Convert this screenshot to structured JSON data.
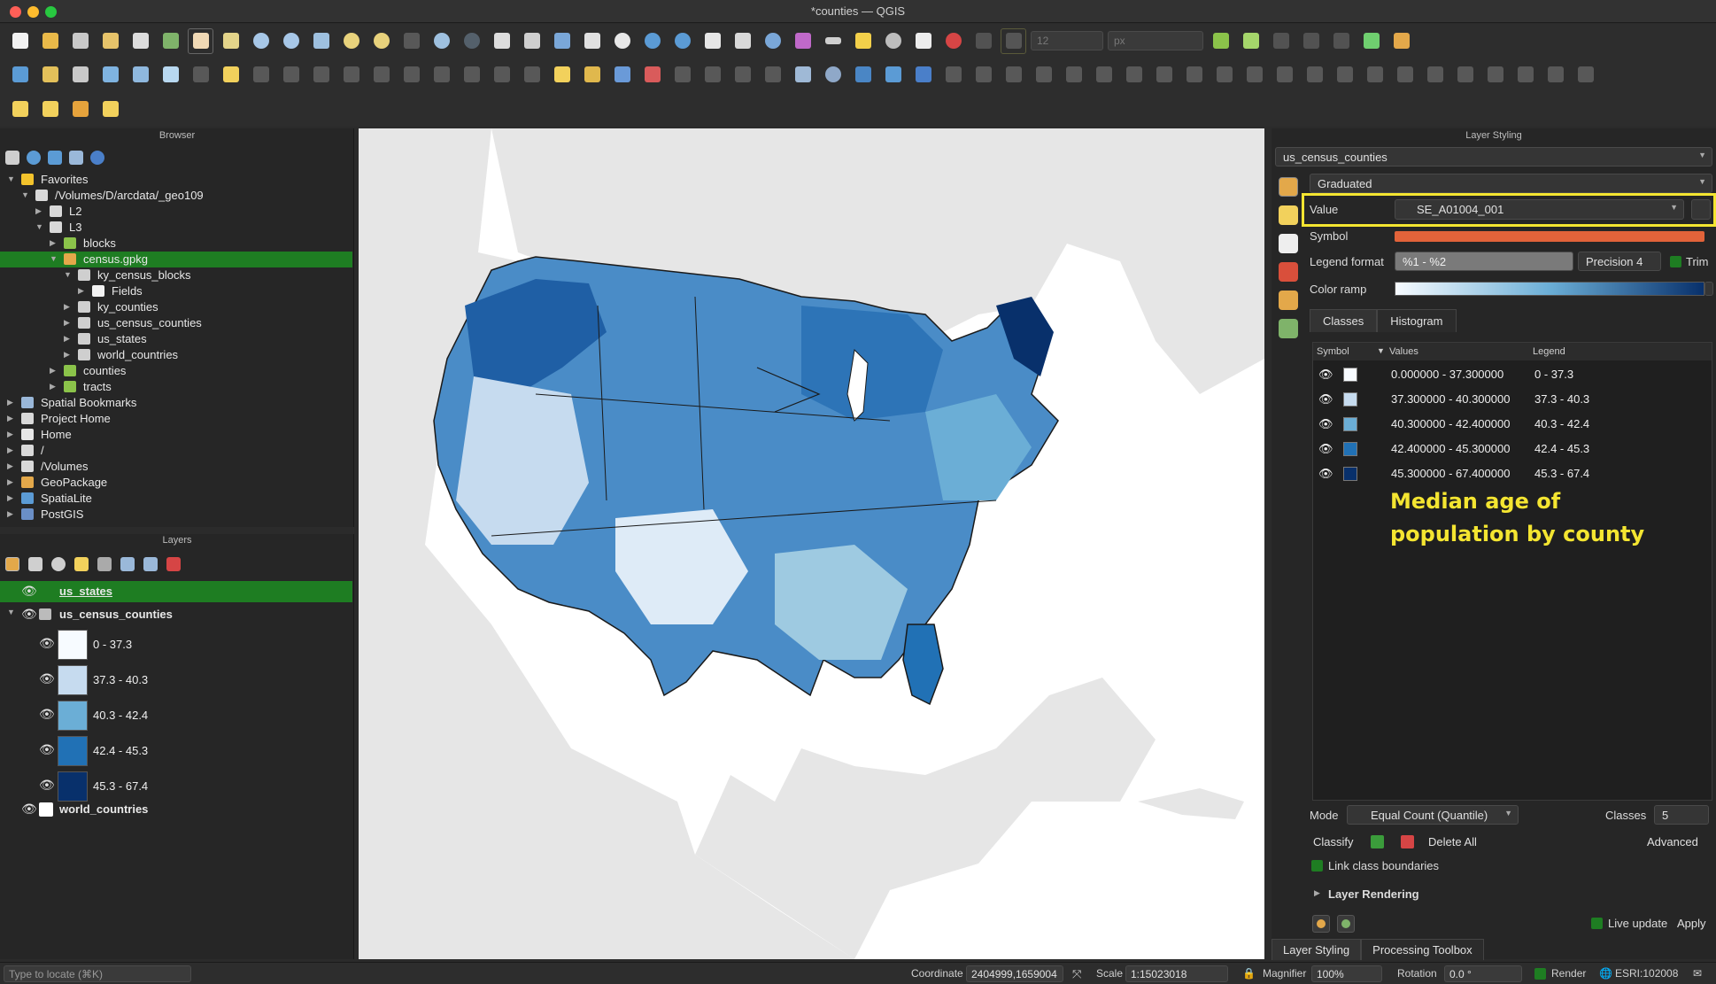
{
  "window": {
    "title": "*counties — QGIS"
  },
  "toolbar": {
    "font_size_value": "12",
    "font_unit_value": "px"
  },
  "browser": {
    "title": "Browser",
    "items": [
      {
        "label": "Favorites",
        "icon": "star-icon"
      },
      {
        "label": "/Volumes/D/arcdata/_geo109",
        "icon": "folder-icon"
      },
      {
        "label": "L2",
        "icon": "folder-icon"
      },
      {
        "label": "L3",
        "icon": "folder-icon"
      },
      {
        "label": "blocks",
        "icon": "query-icon"
      },
      {
        "label": "census.gpkg",
        "icon": "geopackage-icon"
      },
      {
        "label": "ky_census_blocks",
        "icon": "polygon-layer-icon"
      },
      {
        "label": "Fields",
        "icon": "fields-icon"
      },
      {
        "label": "ky_counties",
        "icon": "polygon-layer-icon"
      },
      {
        "label": "us_census_counties",
        "icon": "polygon-layer-icon"
      },
      {
        "label": "us_states",
        "icon": "polygon-layer-icon"
      },
      {
        "label": "world_countries",
        "icon": "polygon-layer-icon"
      },
      {
        "label": "counties",
        "icon": "query-icon"
      },
      {
        "label": "tracts",
        "icon": "query-icon"
      },
      {
        "label": "Spatial Bookmarks",
        "icon": "bookmark-icon"
      },
      {
        "label": "Project Home",
        "icon": "folder-icon"
      },
      {
        "label": "Home",
        "icon": "home-icon"
      },
      {
        "label": "/",
        "icon": "folder-icon"
      },
      {
        "label": "/Volumes",
        "icon": "folder-icon"
      },
      {
        "label": "GeoPackage",
        "icon": "geopackage-icon"
      },
      {
        "label": "SpatiaLite",
        "icon": "spatialite-icon"
      },
      {
        "label": "PostGIS",
        "icon": "postgis-icon"
      }
    ]
  },
  "layers": {
    "title": "Layers",
    "items": [
      {
        "label": "us_states"
      },
      {
        "label": "us_census_counties"
      },
      {
        "label": "world_countries"
      }
    ],
    "legend": [
      {
        "label": "0 - 37.3",
        "color": "#f7fbff"
      },
      {
        "label": "37.3 - 40.3",
        "color": "#c6dbef"
      },
      {
        "label": "40.3 - 42.4",
        "color": "#6baed6"
      },
      {
        "label": "42.4 - 45.3",
        "color": "#2171b5"
      },
      {
        "label": "45.3 - 67.4",
        "color": "#08306b"
      }
    ]
  },
  "styling": {
    "title": "Layer Styling",
    "layer": "us_census_counties",
    "renderer": "Graduated",
    "value_label": "Value",
    "value": "SE_A01004_001",
    "symbol_label": "Symbol",
    "legend_format_label": "Legend format",
    "legend_format": "%1 - %2",
    "precision": "Precision 4",
    "trim": "Trim",
    "color_ramp_label": "Color ramp",
    "tabs": [
      "Classes",
      "Histogram"
    ],
    "columns": [
      "Symbol",
      "Values",
      "Legend"
    ],
    "classes": [
      {
        "values": "0.000000 - 37.300000",
        "legend": "0 - 37.3",
        "color": "#f7fbff"
      },
      {
        "values": "37.300000 - 40.300000",
        "legend": "37.3 - 40.3",
        "color": "#c6dbef"
      },
      {
        "values": "40.300000 - 42.400000",
        "legend": "40.3 - 42.4",
        "color": "#6baed6"
      },
      {
        "values": "42.400000 - 45.300000",
        "legend": "42.4 - 45.3",
        "color": "#2171b5"
      },
      {
        "values": "45.300000 - 67.400000",
        "legend": "45.3 - 67.4",
        "color": "#08306b"
      }
    ],
    "annotation": "Median age of population by county",
    "mode_label": "Mode",
    "mode": "Equal Count (Quantile)",
    "classes_label": "Classes",
    "classes_count": "5",
    "classify": "Classify",
    "delete_all": "Delete All",
    "advanced": "Advanced",
    "link_boundaries": "Link class boundaries",
    "layer_rendering": "Layer Rendering",
    "live_update": "Live update",
    "apply": "Apply",
    "bottom_tabs": [
      "Layer Styling",
      "Processing Toolbox"
    ]
  },
  "statusbar": {
    "locate_placeholder": "Type to locate (⌘K)",
    "coordinate_label": "Coordinate",
    "coordinate": "2404999,1659004",
    "scale_label": "Scale",
    "scale": "1:15023018",
    "magnifier_label": "Magnifier",
    "magnifier": "100%",
    "rotation_label": "Rotation",
    "rotation": "0.0 °",
    "render": "Render",
    "crs": "ESRI:102008"
  }
}
